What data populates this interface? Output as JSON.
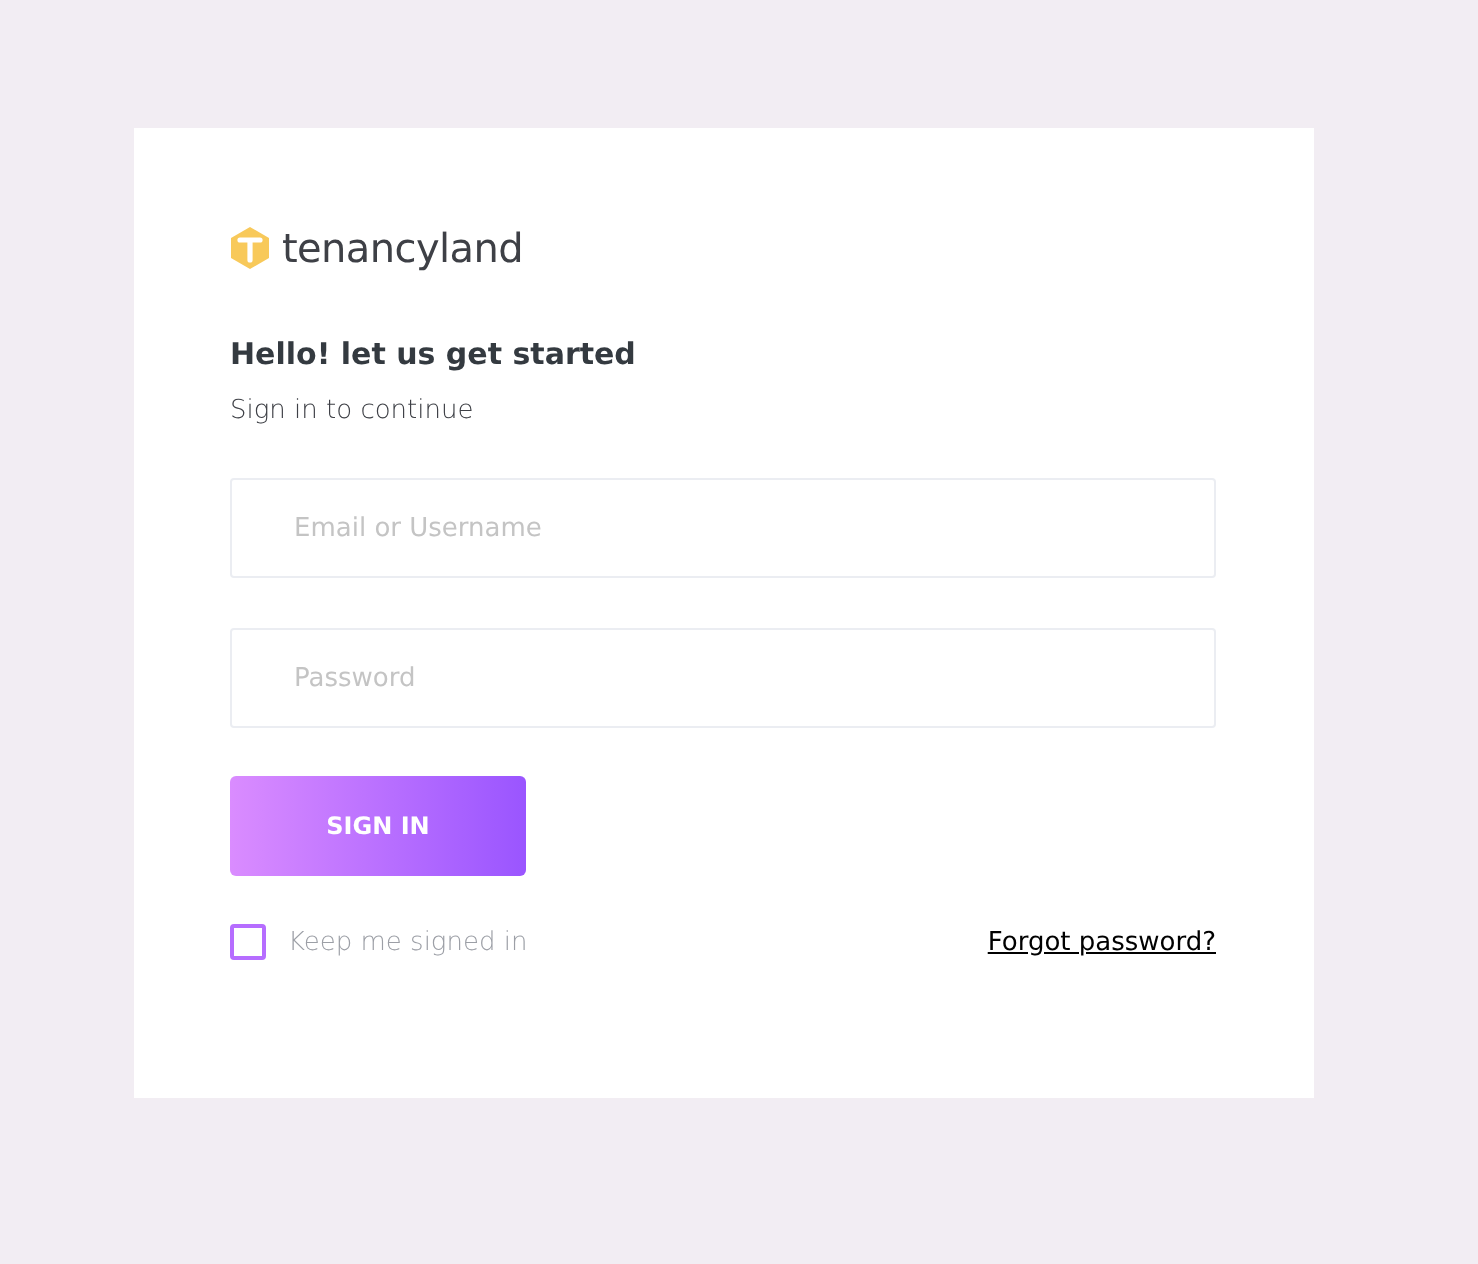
{
  "logo": {
    "text": "tenancyland"
  },
  "heading": "Hello! let us get started",
  "subheading": "Sign in to continue",
  "fields": [
    {
      "placeholder": "Email or Username"
    },
    {
      "placeholder": "Password"
    }
  ],
  "submit": {
    "label": "SIGN IN"
  },
  "remember": {
    "label": "Keep me signed in",
    "checked": false
  },
  "forgot_link": "Forgot password?"
}
